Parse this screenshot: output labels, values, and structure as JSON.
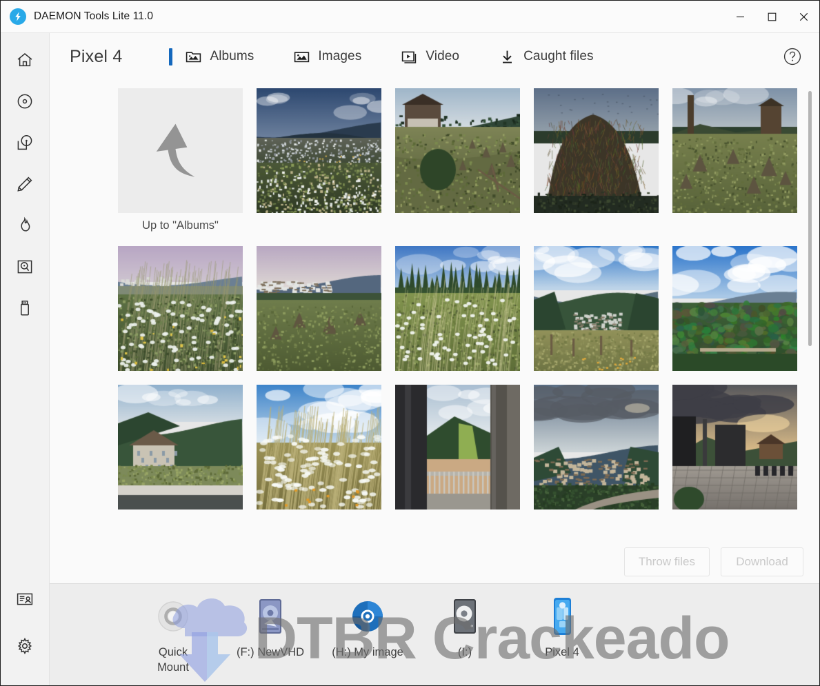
{
  "window": {
    "title": "DAEMON Tools Lite 11.0",
    "logo_icon": "lightning-bolt-circle-icon",
    "controls": {
      "minimize": "minimize-icon",
      "maximize": "maximize-icon",
      "close": "close-icon"
    }
  },
  "sidebar": {
    "items": [
      {
        "icon": "home-icon",
        "name": "home"
      },
      {
        "icon": "disc-icon",
        "name": "images"
      },
      {
        "icon": "disc-drive-icon",
        "name": "virtual-drives"
      },
      {
        "icon": "pencil-icon",
        "name": "image-editor"
      },
      {
        "icon": "flame-icon",
        "name": "burn"
      },
      {
        "icon": "hard-disk-icon",
        "name": "vhd"
      },
      {
        "icon": "usb-icon",
        "name": "usb"
      }
    ],
    "bottom_items": [
      {
        "icon": "license-card-icon",
        "name": "account"
      },
      {
        "icon": "gear-icon",
        "name": "preferences"
      }
    ]
  },
  "header": {
    "page_title": "Pixel 4",
    "help_icon": "question-circle-icon",
    "tabs": [
      {
        "label": "Albums",
        "icon": "folder-photo-icon",
        "active": true
      },
      {
        "label": "Images",
        "icon": "picture-icon",
        "active": false
      },
      {
        "label": "Video",
        "icon": "video-frame-icon",
        "active": false
      },
      {
        "label": "Caught files",
        "icon": "download-arrow-icon",
        "active": false
      }
    ],
    "accent_color": "#1468bd"
  },
  "gallery": {
    "up_tile": {
      "caption": "Up to \"Albums\"",
      "icon": "curved-up-arrow-icon"
    },
    "thumbnails": [
      {
        "name": "village-dusk-meadow",
        "scene": "dusk-village"
      },
      {
        "name": "hillside-haystacks-house",
        "scene": "hillside-house"
      },
      {
        "name": "large-haystack-dusk",
        "scene": "haystack-close"
      },
      {
        "name": "haystacks-field-evening",
        "scene": "haystack-field"
      },
      {
        "name": "wildflower-meadow-village",
        "scene": "wildflowers-dusk"
      },
      {
        "name": "village-pink-sky",
        "scene": "village-pink"
      },
      {
        "name": "meadow-forest-blue-sky",
        "scene": "meadow-forest"
      },
      {
        "name": "mountain-valley-town",
        "scene": "valley-town"
      },
      {
        "name": "forest-panorama-clouds",
        "scene": "forest-panorama"
      },
      {
        "name": "hillside-houses-road",
        "scene": "hillside-road"
      },
      {
        "name": "wildflowers-cloudy-sky",
        "scene": "flowers-clouds"
      },
      {
        "name": "balcony-window-view",
        "scene": "balcony"
      },
      {
        "name": "town-valley-dusk",
        "scene": "town-dusk"
      },
      {
        "name": "terrace-sunset",
        "scene": "terrace-sunset"
      }
    ],
    "scrollbar": {
      "name": "vertical-scrollbar"
    }
  },
  "actions": {
    "throw_files": "Throw files",
    "download": "Download",
    "disabled": true
  },
  "devicebar": {
    "devices": [
      {
        "label": "Quick\nMount",
        "icon": "quick-mount-ring-icon",
        "name": "quick-mount"
      },
      {
        "label": "(F:) NewVHD",
        "icon": "hard-disk-blue-icon",
        "name": "device-f-newvhd"
      },
      {
        "label": "(H:) My image",
        "icon": "disc-blue-icon",
        "name": "device-h-my-image"
      },
      {
        "label": "(I:)",
        "icon": "hard-disk-gray-icon",
        "name": "device-i"
      },
      {
        "label": "Pixel 4",
        "icon": "android-phone-icon",
        "name": "device-pixel-4"
      }
    ]
  },
  "watermark": {
    "text": "DTBR Crackeado"
  }
}
